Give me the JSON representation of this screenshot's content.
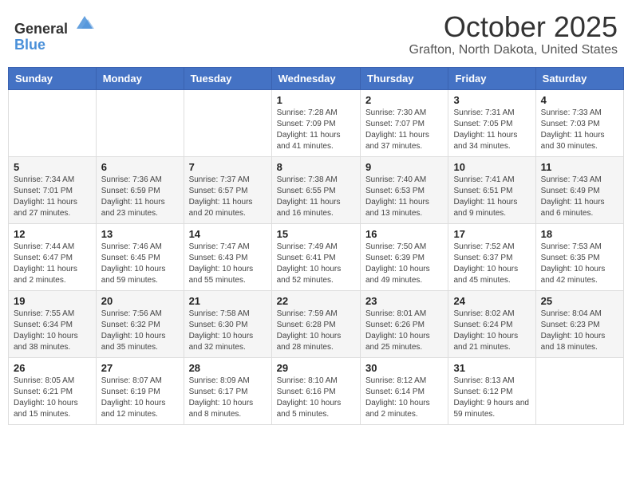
{
  "header": {
    "logo_general": "General",
    "logo_blue": "Blue",
    "month": "October 2025",
    "location": "Grafton, North Dakota, United States"
  },
  "days_of_week": [
    "Sunday",
    "Monday",
    "Tuesday",
    "Wednesday",
    "Thursday",
    "Friday",
    "Saturday"
  ],
  "weeks": [
    [
      {
        "day": "",
        "sunrise": "",
        "sunset": "",
        "daylight": ""
      },
      {
        "day": "",
        "sunrise": "",
        "sunset": "",
        "daylight": ""
      },
      {
        "day": "",
        "sunrise": "",
        "sunset": "",
        "daylight": ""
      },
      {
        "day": "1",
        "sunrise": "Sunrise: 7:28 AM",
        "sunset": "Sunset: 7:09 PM",
        "daylight": "Daylight: 11 hours and 41 minutes."
      },
      {
        "day": "2",
        "sunrise": "Sunrise: 7:30 AM",
        "sunset": "Sunset: 7:07 PM",
        "daylight": "Daylight: 11 hours and 37 minutes."
      },
      {
        "day": "3",
        "sunrise": "Sunrise: 7:31 AM",
        "sunset": "Sunset: 7:05 PM",
        "daylight": "Daylight: 11 hours and 34 minutes."
      },
      {
        "day": "4",
        "sunrise": "Sunrise: 7:33 AM",
        "sunset": "Sunset: 7:03 PM",
        "daylight": "Daylight: 11 hours and 30 minutes."
      }
    ],
    [
      {
        "day": "5",
        "sunrise": "Sunrise: 7:34 AM",
        "sunset": "Sunset: 7:01 PM",
        "daylight": "Daylight: 11 hours and 27 minutes."
      },
      {
        "day": "6",
        "sunrise": "Sunrise: 7:36 AM",
        "sunset": "Sunset: 6:59 PM",
        "daylight": "Daylight: 11 hours and 23 minutes."
      },
      {
        "day": "7",
        "sunrise": "Sunrise: 7:37 AM",
        "sunset": "Sunset: 6:57 PM",
        "daylight": "Daylight: 11 hours and 20 minutes."
      },
      {
        "day": "8",
        "sunrise": "Sunrise: 7:38 AM",
        "sunset": "Sunset: 6:55 PM",
        "daylight": "Daylight: 11 hours and 16 minutes."
      },
      {
        "day": "9",
        "sunrise": "Sunrise: 7:40 AM",
        "sunset": "Sunset: 6:53 PM",
        "daylight": "Daylight: 11 hours and 13 minutes."
      },
      {
        "day": "10",
        "sunrise": "Sunrise: 7:41 AM",
        "sunset": "Sunset: 6:51 PM",
        "daylight": "Daylight: 11 hours and 9 minutes."
      },
      {
        "day": "11",
        "sunrise": "Sunrise: 7:43 AM",
        "sunset": "Sunset: 6:49 PM",
        "daylight": "Daylight: 11 hours and 6 minutes."
      }
    ],
    [
      {
        "day": "12",
        "sunrise": "Sunrise: 7:44 AM",
        "sunset": "Sunset: 6:47 PM",
        "daylight": "Daylight: 11 hours and 2 minutes."
      },
      {
        "day": "13",
        "sunrise": "Sunrise: 7:46 AM",
        "sunset": "Sunset: 6:45 PM",
        "daylight": "Daylight: 10 hours and 59 minutes."
      },
      {
        "day": "14",
        "sunrise": "Sunrise: 7:47 AM",
        "sunset": "Sunset: 6:43 PM",
        "daylight": "Daylight: 10 hours and 55 minutes."
      },
      {
        "day": "15",
        "sunrise": "Sunrise: 7:49 AM",
        "sunset": "Sunset: 6:41 PM",
        "daylight": "Daylight: 10 hours and 52 minutes."
      },
      {
        "day": "16",
        "sunrise": "Sunrise: 7:50 AM",
        "sunset": "Sunset: 6:39 PM",
        "daylight": "Daylight: 10 hours and 49 minutes."
      },
      {
        "day": "17",
        "sunrise": "Sunrise: 7:52 AM",
        "sunset": "Sunset: 6:37 PM",
        "daylight": "Daylight: 10 hours and 45 minutes."
      },
      {
        "day": "18",
        "sunrise": "Sunrise: 7:53 AM",
        "sunset": "Sunset: 6:35 PM",
        "daylight": "Daylight: 10 hours and 42 minutes."
      }
    ],
    [
      {
        "day": "19",
        "sunrise": "Sunrise: 7:55 AM",
        "sunset": "Sunset: 6:34 PM",
        "daylight": "Daylight: 10 hours and 38 minutes."
      },
      {
        "day": "20",
        "sunrise": "Sunrise: 7:56 AM",
        "sunset": "Sunset: 6:32 PM",
        "daylight": "Daylight: 10 hours and 35 minutes."
      },
      {
        "day": "21",
        "sunrise": "Sunrise: 7:58 AM",
        "sunset": "Sunset: 6:30 PM",
        "daylight": "Daylight: 10 hours and 32 minutes."
      },
      {
        "day": "22",
        "sunrise": "Sunrise: 7:59 AM",
        "sunset": "Sunset: 6:28 PM",
        "daylight": "Daylight: 10 hours and 28 minutes."
      },
      {
        "day": "23",
        "sunrise": "Sunrise: 8:01 AM",
        "sunset": "Sunset: 6:26 PM",
        "daylight": "Daylight: 10 hours and 25 minutes."
      },
      {
        "day": "24",
        "sunrise": "Sunrise: 8:02 AM",
        "sunset": "Sunset: 6:24 PM",
        "daylight": "Daylight: 10 hours and 21 minutes."
      },
      {
        "day": "25",
        "sunrise": "Sunrise: 8:04 AM",
        "sunset": "Sunset: 6:23 PM",
        "daylight": "Daylight: 10 hours and 18 minutes."
      }
    ],
    [
      {
        "day": "26",
        "sunrise": "Sunrise: 8:05 AM",
        "sunset": "Sunset: 6:21 PM",
        "daylight": "Daylight: 10 hours and 15 minutes."
      },
      {
        "day": "27",
        "sunrise": "Sunrise: 8:07 AM",
        "sunset": "Sunset: 6:19 PM",
        "daylight": "Daylight: 10 hours and 12 minutes."
      },
      {
        "day": "28",
        "sunrise": "Sunrise: 8:09 AM",
        "sunset": "Sunset: 6:17 PM",
        "daylight": "Daylight: 10 hours and 8 minutes."
      },
      {
        "day": "29",
        "sunrise": "Sunrise: 8:10 AM",
        "sunset": "Sunset: 6:16 PM",
        "daylight": "Daylight: 10 hours and 5 minutes."
      },
      {
        "day": "30",
        "sunrise": "Sunrise: 8:12 AM",
        "sunset": "Sunset: 6:14 PM",
        "daylight": "Daylight: 10 hours and 2 minutes."
      },
      {
        "day": "31",
        "sunrise": "Sunrise: 8:13 AM",
        "sunset": "Sunset: 6:12 PM",
        "daylight": "Daylight: 9 hours and 59 minutes."
      },
      {
        "day": "",
        "sunrise": "",
        "sunset": "",
        "daylight": ""
      }
    ]
  ]
}
